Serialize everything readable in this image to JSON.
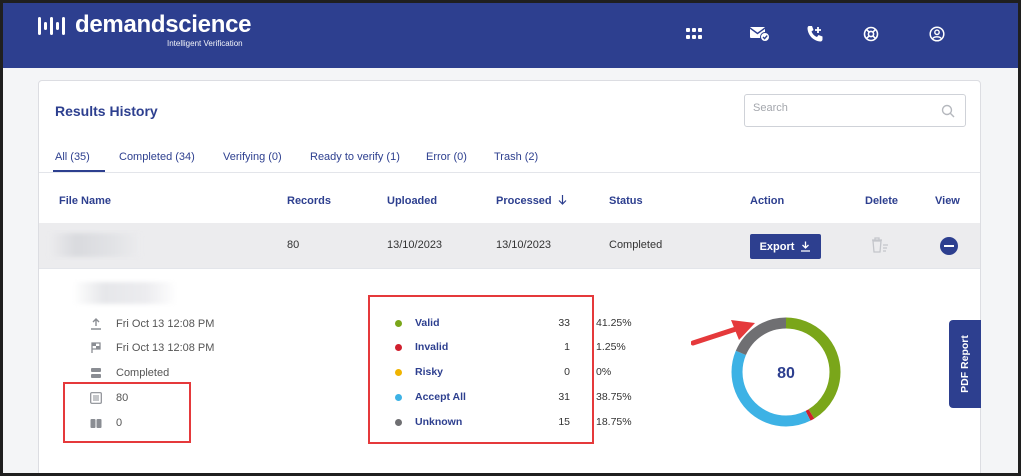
{
  "brand": {
    "name": "demandscience",
    "tagline": "Intelligent Verification"
  },
  "topnav": {
    "icons": [
      "apps-grid-icon",
      "mail-verify-icon",
      "phone-add-icon",
      "help-lifebuoy-icon",
      "account-icon"
    ]
  },
  "page": {
    "title": "Results History",
    "search_placeholder": "Search"
  },
  "tabs": [
    {
      "label": "All (35)",
      "active": true
    },
    {
      "label": "Completed (34)",
      "active": false
    },
    {
      "label": "Verifying (0)",
      "active": false
    },
    {
      "label": "Ready to verify (1)",
      "active": false
    },
    {
      "label": "Error (0)",
      "active": false
    },
    {
      "label": "Trash (2)",
      "active": false
    }
  ],
  "table": {
    "headers": {
      "file_name": "File Name",
      "records": "Records",
      "uploaded": "Uploaded",
      "processed": "Processed",
      "status": "Status",
      "action": "Action",
      "delete": "Delete",
      "view": "View"
    },
    "row": {
      "records": "80",
      "uploaded": "13/10/2023",
      "processed": "13/10/2023",
      "status": "Completed",
      "export_label": "Export"
    }
  },
  "details": {
    "uploaded_at": "Fri Oct 13 12:08 PM",
    "processed_at": "Fri Oct 13 12:08 PM",
    "status": "Completed",
    "records": "80",
    "duplicates": "0",
    "stats": [
      {
        "label": "Valid",
        "count": "33",
        "pct": "41.25%",
        "color": "#7aa61a"
      },
      {
        "label": "Invalid",
        "count": "1",
        "pct": "1.25%",
        "color": "#d0202e"
      },
      {
        "label": "Risky",
        "count": "0",
        "pct": "0%",
        "color": "#f0b400"
      },
      {
        "label": "Accept All",
        "count": "31",
        "pct": "38.75%",
        "color": "#3db2e5"
      },
      {
        "label": "Unknown",
        "count": "15",
        "pct": "18.75%",
        "color": "#6f6f72"
      }
    ],
    "total": "80",
    "pdf_report_label": "PDF Report"
  },
  "chart_data": {
    "type": "pie",
    "categories": [
      "Valid",
      "Invalid",
      "Risky",
      "Accept All",
      "Unknown"
    ],
    "values": [
      33,
      1,
      0,
      31,
      15
    ],
    "colors": [
      "#7aa61a",
      "#d0202e",
      "#f0b400",
      "#3db2e5",
      "#6f6f72"
    ],
    "center_label": "80"
  }
}
